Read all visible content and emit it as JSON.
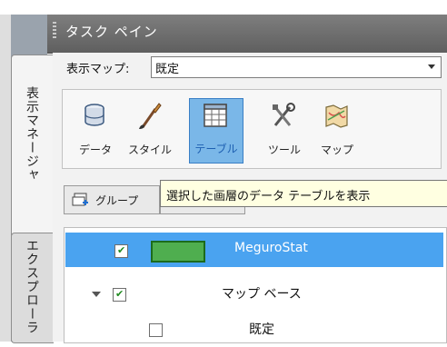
{
  "task_pane": {
    "title": "タスク ペイン"
  },
  "side_tabs": {
    "active": "表示マネージャ",
    "inactive": "エクスプローラ"
  },
  "map_selector": {
    "label": "表示マップ:",
    "value": "既定"
  },
  "toolbar": {
    "items": [
      {
        "label": "データ",
        "icon": "database-icon"
      },
      {
        "label": "スタイル",
        "icon": "brush-icon"
      },
      {
        "label": "テーブル",
        "icon": "table-icon",
        "selected": true
      },
      {
        "label": "ツール",
        "icon": "tools-icon"
      },
      {
        "label": "マップ",
        "icon": "map-icon"
      }
    ]
  },
  "group_button": {
    "label": "グループ"
  },
  "tooltip": {
    "text": "選択した画層のデータ テーブルを表示"
  },
  "layers": [
    {
      "name": "MeguroStat",
      "checked": true,
      "selected": true,
      "color": "#4fae4f"
    },
    {
      "name": "マップ ベース",
      "checked": true,
      "expandable": true
    },
    {
      "name": "既定",
      "checked": false
    }
  ],
  "colors": {
    "selection": "#4aa3f0",
    "tool_selected": "#7ab7e8"
  }
}
